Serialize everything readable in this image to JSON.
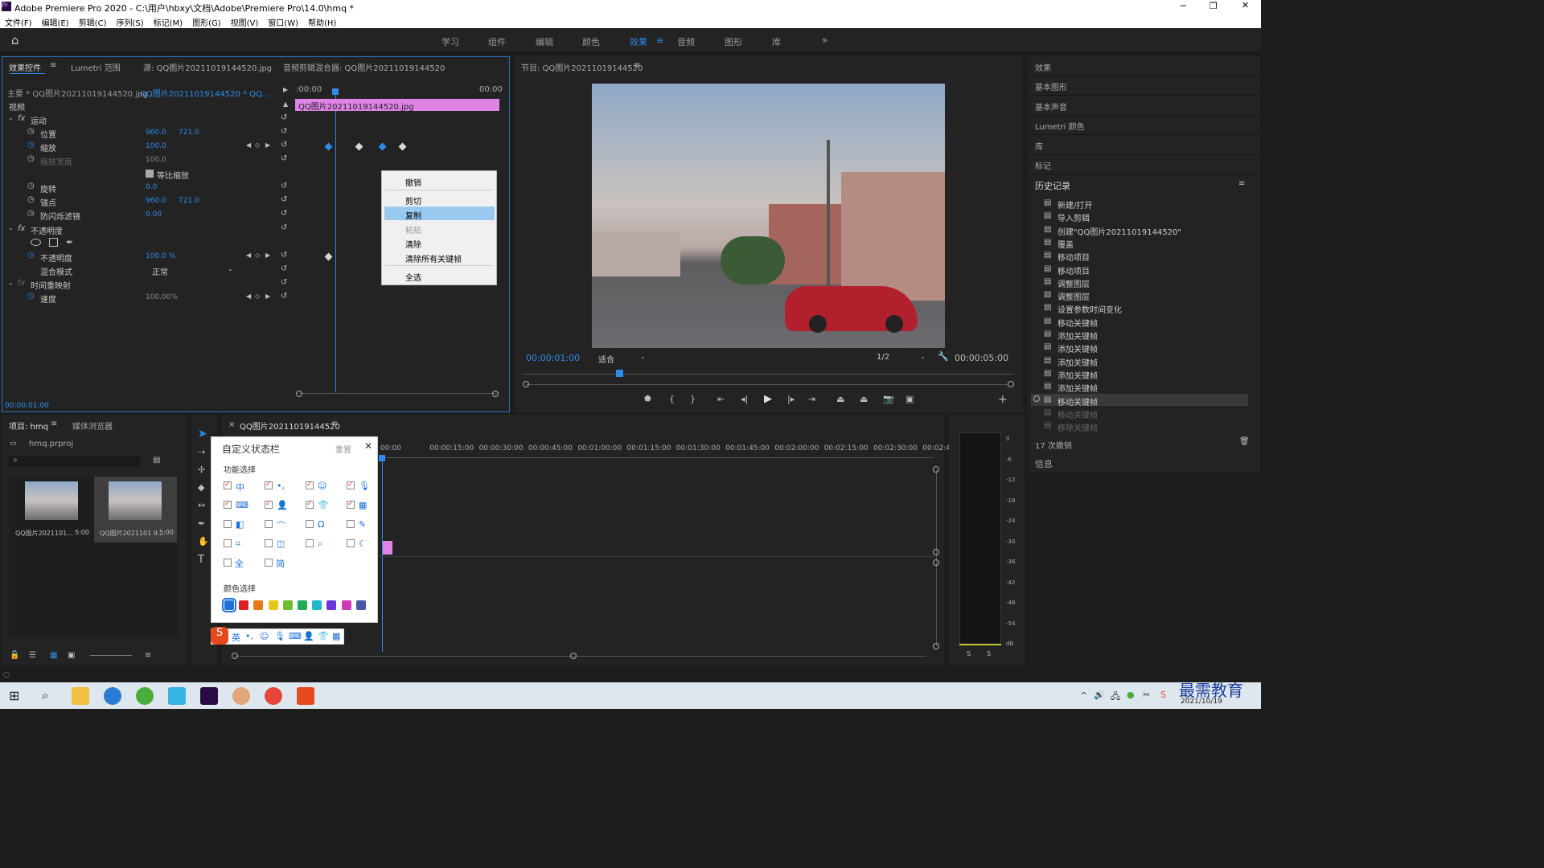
{
  "window": {
    "title": "Adobe Premiere Pro 2020 - C:\\用户\\hbxy\\文档\\Adobe\\Premiere Pro\\14.0\\hmq *"
  },
  "menu": [
    "文件(F)",
    "编辑(E)",
    "剪辑(C)",
    "序列(S)",
    "标记(M)",
    "图形(G)",
    "视图(V)",
    "窗口(W)",
    "帮助(H)"
  ],
  "workspaces": [
    "学习",
    "组件",
    "编辑",
    "颜色",
    "效果",
    "音频",
    "图形",
    "库"
  ],
  "effect_controls": {
    "tabs": [
      "效果控件",
      "Lumetri 范围",
      "源: QQ图片20211019144520.jpg",
      "音频剪辑混合器: QQ图片20211019144520"
    ],
    "master": "主要 * QQ图片20211019144520.jpg",
    "seq": "QQ图片20211019144520 * QQ...",
    "section": "视频",
    "t0": ":00:00",
    "t1": "00:00",
    "clip": "QQ图片20211019144520.jpg",
    "motion": "运动",
    "position": "位置",
    "pos_x": "960.0",
    "pos_y": "721.0",
    "scale": "缩放",
    "scale_v": "100.0",
    "scalew": "缩放宽度",
    "scalew_v": "100.0",
    "uniform": "等比缩放",
    "rotation": "旋转",
    "rot_v": "0.0",
    "anchor": "锚点",
    "anc_x": "960.0",
    "anc_y": "721.0",
    "flicker": "防闪烁滤镜",
    "flicker_v": "0.00",
    "opacity_fx": "不透明度",
    "opacity": "不透明度",
    "opacity_v": "100.0 %",
    "blend": "混合模式",
    "blend_v": "正常",
    "timeremap": "时间重映射",
    "speed": "速度",
    "speed_v": "100.00%",
    "timecode": "00:00:01:00"
  },
  "context_menu": [
    "撤销",
    "剪切",
    "复制",
    "粘贴",
    "清除",
    "清除所有关键帧",
    "全选"
  ],
  "program": {
    "title": "节目: QQ图片20211019144520",
    "tc": "00:00:01:00",
    "fit": "适合",
    "res": "1/2",
    "dur": "00:00:05:00"
  },
  "right_panel": {
    "items": [
      "效果",
      "基本图形",
      "基本声音",
      "Lumetri 颜色",
      "库",
      "标记"
    ],
    "history_title": "历史记录",
    "history": [
      "新建/打开",
      "导入剪辑",
      "创建\"QQ图片20211019144520\"",
      "覆盖",
      "移动项目",
      "移动项目",
      "调整图层",
      "调整图层",
      "设置参数时间变化",
      "移动关键帧",
      "添加关键帧",
      "添加关键帧",
      "添加关键帧",
      "添加关键帧",
      "添加关键帧",
      "移动关键帧",
      "移动关键帧",
      "移除关键帧"
    ],
    "undo": "17 次撤销",
    "info": "信息"
  },
  "project": {
    "tabs": [
      "项目: hmq",
      "媒体浏览器"
    ],
    "file": "hmq.prproj",
    "items": [
      {
        "name": "QQ图片2021101...",
        "dur": "5:00"
      },
      {
        "name": "QQ图片2021101 9...",
        "dur": "5:00"
      }
    ]
  },
  "timeline": {
    "tab": "QQ图片20211019144520",
    "ticks": [
      "00:00",
      "00:00:15:00",
      "00:00:30:00",
      "00:00:45:00",
      "00:01:00:00",
      "00:01:15:00",
      "00:01:30:00",
      "00:01:45:00",
      "00:02:00:00",
      "00:02:15:00",
      "00:02:30:00",
      "00:02:45:"
    ]
  },
  "meter": {
    "ticks": [
      "0",
      "-6",
      "-12",
      "-18",
      "-24",
      "-30",
      "-36",
      "-42",
      "-48",
      "-54",
      "dB"
    ],
    "s": "S"
  },
  "ime": {
    "title": "自定义状态栏",
    "reset": "重置",
    "func": "功能选择",
    "color": "颜色选择",
    "row5a": "全",
    "row5b": "简",
    "bar": "英"
  },
  "taskbar": {
    "date": "2021/10/19",
    "watermark": "最需教育"
  }
}
